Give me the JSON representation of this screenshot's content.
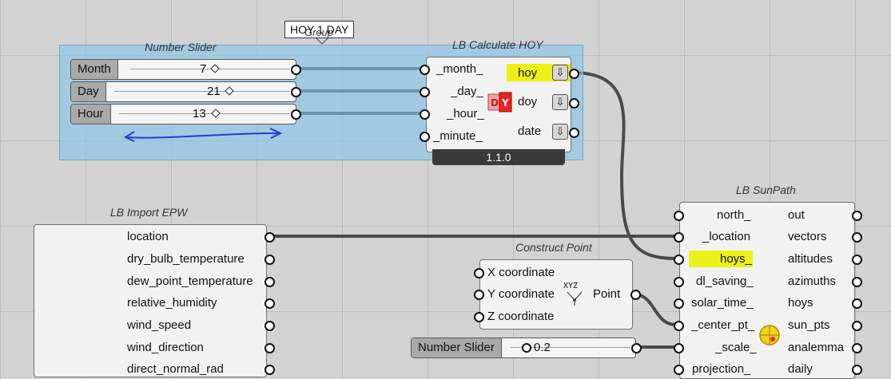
{
  "scribble": {
    "text": "HOY 1 DAY",
    "group_label": "Group"
  },
  "slider_group": {
    "title": "Number Slider",
    "sliders": [
      {
        "label": "Month",
        "value": "7"
      },
      {
        "label": "Day",
        "value": "21"
      },
      {
        "label": "Hour",
        "value": "13"
      }
    ]
  },
  "hoy": {
    "title": "LB Calculate HOY",
    "inputs": [
      "_month_",
      "_day_",
      "_hour_",
      "_minute_"
    ],
    "outputs": [
      "hoy",
      "doy",
      "date"
    ],
    "version": "1.1.0",
    "icon": "calendar-dy-icon"
  },
  "epw": {
    "title": "LB Import EPW",
    "outputs": [
      "location",
      "dry_bulb_temperature",
      "dew_point_temperature",
      "relative_humidity",
      "wind_speed",
      "wind_direction",
      "direct_normal_rad"
    ]
  },
  "sunpath": {
    "title": "LB SunPath",
    "inputs": [
      "north_",
      "_location",
      "hoys_",
      "dl_saving_",
      "solar_time_",
      "_center_pt_",
      "_scale_",
      "projection_"
    ],
    "outputs": [
      "out",
      "vectors",
      "altitudes",
      "azimuths",
      "hoys",
      "sun_pts",
      "analemma",
      "daily"
    ],
    "icon": "sun-icon"
  },
  "construct_point": {
    "title": "Construct Point",
    "inputs": [
      "X coordinate",
      "Y coordinate",
      "Z coordinate"
    ],
    "output": "Point",
    "icon_text": "XYZ"
  },
  "scale_slider": {
    "label": "Number Slider",
    "value": "0.2"
  },
  "colors": {
    "highlight": "#ecf017",
    "group_fill": "#84c4ec",
    "wire": "#4a4a4a",
    "annotation": "#1f3fd0"
  }
}
